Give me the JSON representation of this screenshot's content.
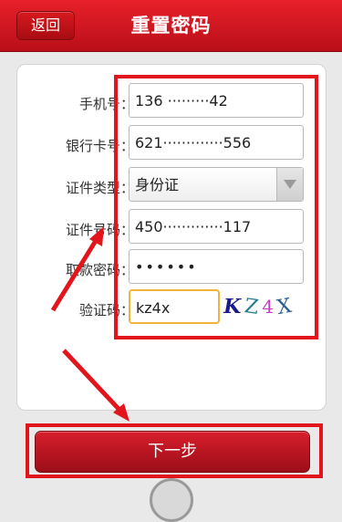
{
  "header": {
    "back_label": "返回",
    "title": "重置密码"
  },
  "form": {
    "phone": {
      "label": "手机号：",
      "value": "136 ·········42"
    },
    "card": {
      "label": "银行卡号：",
      "value": "621·············556"
    },
    "id_type": {
      "label": "证件类型：",
      "value": "身份证"
    },
    "id_number": {
      "label": "证件号码：",
      "value": "450·············117"
    },
    "pin": {
      "label": "取款密码：",
      "value": "••••••"
    },
    "captcha": {
      "label": "验证码：",
      "value": "kz4x",
      "image_chars": [
        "K",
        "Z",
        "4",
        "X"
      ]
    }
  },
  "actions": {
    "next_label": "下一步"
  },
  "colors": {
    "header_red": "#e8202a",
    "annotation_red": "#e3151c",
    "captcha_border": "#f0b43b"
  }
}
